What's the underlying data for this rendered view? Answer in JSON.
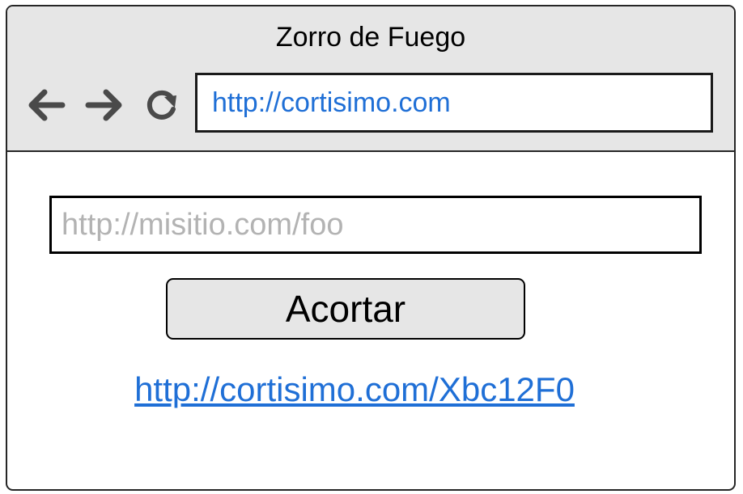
{
  "window": {
    "title": "Zorro de Fuego"
  },
  "toolbar": {
    "back_icon": "arrow-left-icon",
    "forward_icon": "arrow-right-icon",
    "reload_icon": "reload-icon",
    "address": "http://cortisimo.com"
  },
  "form": {
    "url_input_value": "",
    "url_input_placeholder": "http://misitio.com/foo",
    "submit_label": "Acortar"
  },
  "result": {
    "short_url": "http://cortisimo.com/Xbc12F0"
  },
  "colors": {
    "chrome_background": "#e6e6e6",
    "link": "#1f6fd6",
    "placeholder": "#b3b3b3",
    "button_background": "#e6e6e6"
  }
}
